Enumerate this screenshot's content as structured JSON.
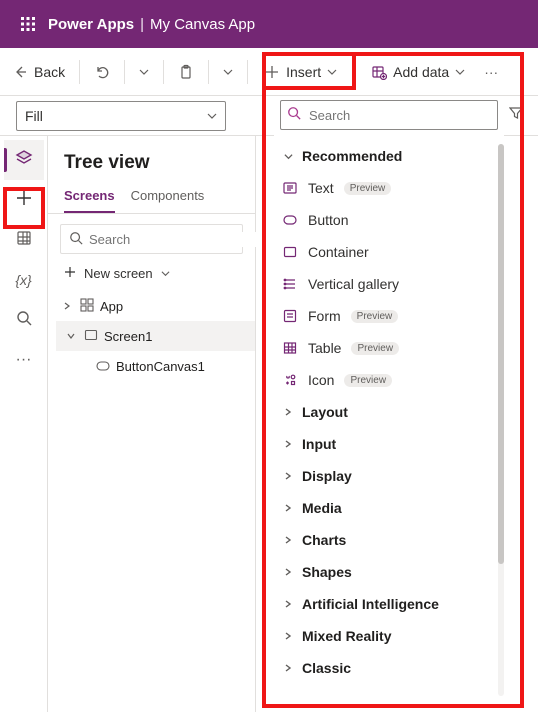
{
  "header": {
    "app": "Power Apps",
    "file": "My Canvas App"
  },
  "toolbar": {
    "back": "Back",
    "insert": "Insert",
    "add_data": "Add data"
  },
  "property_dropdown": {
    "value": "Fill"
  },
  "left_panel": {
    "title": "Tree view",
    "tabs": {
      "screens": "Screens",
      "components": "Components"
    },
    "search_placeholder": "Search",
    "new_screen": "New screen",
    "tree": {
      "app": "App",
      "screen1": "Screen1",
      "btn": "ButtonCanvas1"
    }
  },
  "insert_panel": {
    "search_placeholder": "Search",
    "recommended_label": "Recommended",
    "items": {
      "text": "Text",
      "button": "Button",
      "container": "Container",
      "vgal": "Vertical gallery",
      "form": "Form",
      "table": "Table",
      "icon": "Icon"
    },
    "categories": {
      "layout": "Layout",
      "input": "Input",
      "display": "Display",
      "media": "Media",
      "charts": "Charts",
      "shapes": "Shapes",
      "ai": "Artificial Intelligence",
      "mr": "Mixed Reality",
      "classic": "Classic"
    },
    "preview_badge": "Preview"
  }
}
